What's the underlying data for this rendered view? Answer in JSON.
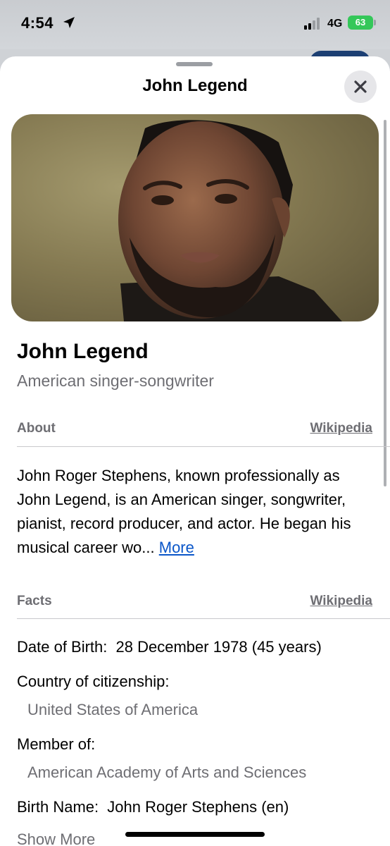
{
  "status_bar": {
    "time": "4:54",
    "network": "4G",
    "battery": "63"
  },
  "sheet": {
    "title": "John Legend"
  },
  "entity": {
    "name": "John Legend",
    "subtitle": "American singer-songwriter"
  },
  "about": {
    "label": "About",
    "source": "Wikipedia",
    "text": "John Roger Stephens, known professionally as John Legend, is an American singer, songwriter, pianist, record producer, and actor. He began his musical career wo...",
    "more": "More"
  },
  "facts": {
    "label": "Facts",
    "source": "Wikipedia",
    "date_of_birth_label": "Date of Birth:",
    "date_of_birth_value": "28 December 1978 (45 years)",
    "citizenship_label": "Country of citizenship:",
    "citizenship_value": "United States of America",
    "member_label": "Member of:",
    "member_value": "American Academy of Arts and Sciences",
    "birth_name_label": "Birth Name:",
    "birth_name_value": "John Roger Stephens (en)",
    "show_more": "Show More"
  },
  "icons": {
    "location": "location-arrow-icon",
    "signal": "cellular-signal-icon",
    "battery": "battery-icon",
    "close": "close-icon"
  },
  "colors": {
    "accent_link": "#0a56c9",
    "secondary_text": "#6e6e73",
    "battery": "#34c759"
  }
}
